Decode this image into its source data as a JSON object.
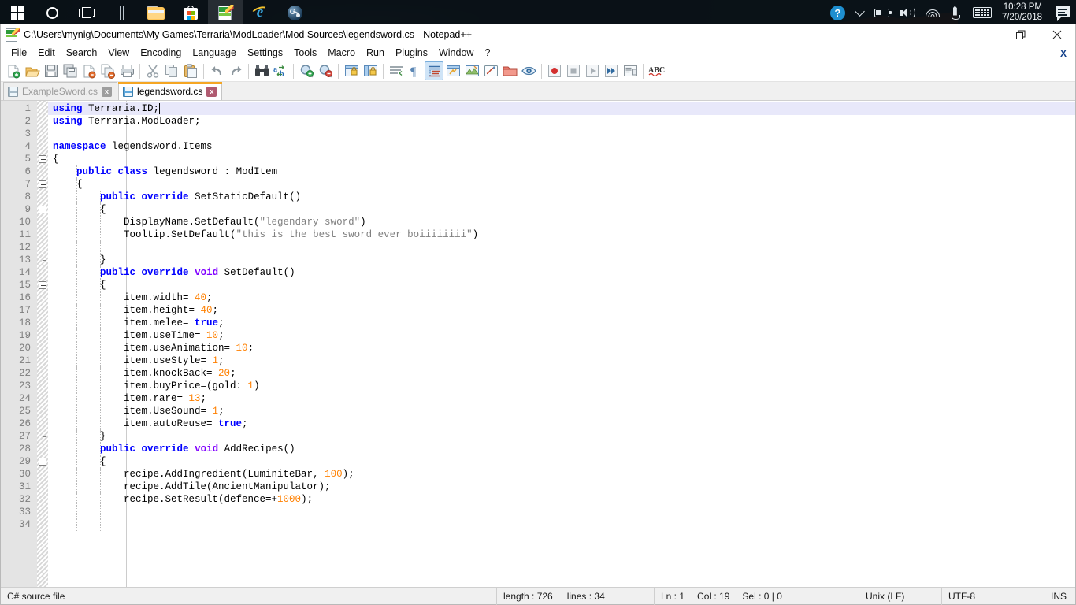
{
  "taskbar": {
    "items": [
      {
        "name": "start-button",
        "icon": "windows-logo-icon",
        "label": "Start"
      },
      {
        "name": "cortana-button",
        "icon": "cortana-circle-icon",
        "label": "Cortana"
      },
      {
        "name": "task-view-button",
        "icon": "task-view-icon",
        "label": "Task View"
      },
      {
        "name": "file-explorer-button",
        "icon": "folder-icon",
        "label": "File Explorer"
      },
      {
        "name": "microsoft-store-button",
        "icon": "store-bag-icon",
        "label": "Microsoft Store"
      },
      {
        "name": "notepadpp-taskbar-button",
        "icon": "notepad-plus-plus-icon",
        "label": "Notepad++"
      },
      {
        "name": "internet-explorer-button",
        "icon": "internet-explorer-icon",
        "label": "Internet Explorer"
      },
      {
        "name": "steam-button",
        "icon": "steam-icon",
        "label": "Steam"
      }
    ],
    "tray": {
      "help_icon": "help-question-icon",
      "help_glyph": "?",
      "chevron": "chevron-up-icon",
      "battery": "battery-icon",
      "volume": "volume-icon",
      "wifi": "wifi-icon",
      "pen": "pen-ink-icon",
      "keyboard": "touch-keyboard-icon",
      "time": "10:28 PM",
      "date": "7/20/2018",
      "action_center": "action-center-icon"
    }
  },
  "window": {
    "title": "C:\\Users\\mynig\\Documents\\My Games\\Terraria\\ModLoader\\Mod Sources\\legendsword.cs - Notepad++",
    "icon": "notepad-plus-plus-icon",
    "minimize": "minimize-icon",
    "maximize": "restore-icon",
    "close": "close-icon",
    "document_close_label": "X"
  },
  "menu": {
    "items": [
      {
        "label": "File"
      },
      {
        "label": "Edit"
      },
      {
        "label": "Search"
      },
      {
        "label": "View"
      },
      {
        "label": "Encoding"
      },
      {
        "label": "Language"
      },
      {
        "label": "Settings"
      },
      {
        "label": "Tools"
      },
      {
        "label": "Macro"
      },
      {
        "label": "Run"
      },
      {
        "label": "Plugins"
      },
      {
        "label": "Window"
      },
      {
        "label": "?"
      }
    ]
  },
  "toolbar": {
    "buttons": [
      {
        "name": "new-file-button",
        "icon": "new-document-icon"
      },
      {
        "name": "open-file-button",
        "icon": "open-folder-icon"
      },
      {
        "name": "save-button",
        "icon": "save-floppy-icon"
      },
      {
        "name": "save-all-button",
        "icon": "save-all-icon"
      },
      {
        "name": "close-button",
        "icon": "close-document-icon"
      },
      {
        "name": "close-all-button",
        "icon": "close-all-documents-icon"
      },
      {
        "name": "print-button",
        "icon": "printer-icon"
      },
      {
        "name": "cut-button",
        "icon": "scissors-icon"
      },
      {
        "name": "copy-button",
        "icon": "copy-icon"
      },
      {
        "name": "paste-button",
        "icon": "paste-clipboard-icon"
      },
      {
        "name": "undo-button",
        "icon": "undo-arrow-icon"
      },
      {
        "name": "redo-button",
        "icon": "redo-arrow-icon"
      },
      {
        "name": "find-button",
        "icon": "binoculars-find-icon"
      },
      {
        "name": "replace-button",
        "icon": "replace-ab-icon"
      },
      {
        "name": "zoom-in-button",
        "icon": "magnifier-plus-icon"
      },
      {
        "name": "zoom-out-button",
        "icon": "magnifier-minus-icon"
      },
      {
        "name": "sync-vertical-scroll-button",
        "icon": "sync-vertical-lock-icon"
      },
      {
        "name": "sync-horizontal-scroll-button",
        "icon": "sync-horizontal-lock-icon"
      },
      {
        "name": "word-wrap-button",
        "icon": "word-wrap-icon"
      },
      {
        "name": "show-all-characters-button",
        "icon": "pilcrow-icon"
      },
      {
        "name": "indent-guide-button",
        "icon": "indent-guide-icon",
        "selected": true
      },
      {
        "name": "user-defined-dialog-button",
        "icon": "udl-dialog-icon"
      },
      {
        "name": "document-map-button",
        "icon": "document-map-icon"
      },
      {
        "name": "function-list-button",
        "icon": "function-list-icon"
      },
      {
        "name": "folder-as-workspace-button",
        "icon": "folder-workspace-icon"
      },
      {
        "name": "monitoring-button",
        "icon": "eye-monitor-icon"
      },
      {
        "name": "start-recording-button",
        "icon": "record-dot-icon"
      },
      {
        "name": "stop-recording-button",
        "icon": "stop-square-icon"
      },
      {
        "name": "playback-button",
        "icon": "play-triangle-icon"
      },
      {
        "name": "run-macro-multiple-button",
        "icon": "fast-forward-icon"
      },
      {
        "name": "save-macro-button",
        "icon": "save-macro-icon"
      },
      {
        "name": "spell-check-button",
        "icon": "abc-spellcheck-icon"
      }
    ]
  },
  "tabs": [
    {
      "label": "ExampleSword.cs",
      "active": false,
      "close": "x"
    },
    {
      "label": "legendsword.cs",
      "active": true,
      "close": "x"
    }
  ],
  "editor": {
    "caret_line": 1,
    "caret_col": 19,
    "lines": [
      {
        "n": 1,
        "tokens": [
          {
            "t": "using",
            "c": "kw"
          },
          {
            "t": " Terraria.ID;",
            "c": ""
          }
        ],
        "fold": "none"
      },
      {
        "n": 2,
        "tokens": [
          {
            "t": "using",
            "c": "kw"
          },
          {
            "t": " Terraria.ModLoader;",
            "c": ""
          }
        ],
        "fold": "none"
      },
      {
        "n": 3,
        "tokens": [],
        "fold": "none"
      },
      {
        "n": 4,
        "tokens": [
          {
            "t": "namespace",
            "c": "kw"
          },
          {
            "t": " legendsword.Items",
            "c": ""
          }
        ],
        "fold": "none"
      },
      {
        "n": 5,
        "tokens": [
          {
            "t": "{",
            "c": ""
          }
        ],
        "fold": "box"
      },
      {
        "n": 6,
        "tokens": [
          {
            "t": "    ",
            "c": ""
          },
          {
            "t": "public",
            "c": "kw"
          },
          {
            "t": " ",
            "c": ""
          },
          {
            "t": "class",
            "c": "kw"
          },
          {
            "t": " legendsword : ModItem",
            "c": ""
          }
        ],
        "fold": "line"
      },
      {
        "n": 7,
        "tokens": [
          {
            "t": "    {",
            "c": ""
          }
        ],
        "fold": "box"
      },
      {
        "n": 8,
        "tokens": [
          {
            "t": "        ",
            "c": ""
          },
          {
            "t": "public",
            "c": "kw"
          },
          {
            "t": " ",
            "c": ""
          },
          {
            "t": "override",
            "c": "kw"
          },
          {
            "t": " SetStaticDefault()",
            "c": ""
          }
        ],
        "fold": "line"
      },
      {
        "n": 9,
        "tokens": [
          {
            "t": "        {",
            "c": ""
          }
        ],
        "fold": "box"
      },
      {
        "n": 10,
        "tokens": [
          {
            "t": "            DisplayName.SetDefault(",
            "c": ""
          },
          {
            "t": "\"legendary sword\"",
            "c": "str"
          },
          {
            "t": ")",
            "c": ""
          }
        ],
        "fold": "line"
      },
      {
        "n": 11,
        "tokens": [
          {
            "t": "            Tooltip.SetDefault(",
            "c": ""
          },
          {
            "t": "\"this is the best sword ever boiiiiiiii\"",
            "c": "str"
          },
          {
            "t": ")",
            "c": ""
          }
        ],
        "fold": "line"
      },
      {
        "n": 12,
        "tokens": [],
        "fold": "line"
      },
      {
        "n": 13,
        "tokens": [
          {
            "t": "        }",
            "c": ""
          }
        ],
        "fold": "end"
      },
      {
        "n": 14,
        "tokens": [
          {
            "t": "        ",
            "c": ""
          },
          {
            "t": "public",
            "c": "kw"
          },
          {
            "t": " ",
            "c": ""
          },
          {
            "t": "override",
            "c": "kw"
          },
          {
            "t": " ",
            "c": ""
          },
          {
            "t": "void",
            "c": "kw2"
          },
          {
            "t": " SetDefault()",
            "c": ""
          }
        ],
        "fold": "line"
      },
      {
        "n": 15,
        "tokens": [
          {
            "t": "        {",
            "c": ""
          }
        ],
        "fold": "box"
      },
      {
        "n": 16,
        "tokens": [
          {
            "t": "            item.width= ",
            "c": ""
          },
          {
            "t": "40",
            "c": "num"
          },
          {
            "t": ";",
            "c": ""
          }
        ],
        "fold": "line"
      },
      {
        "n": 17,
        "tokens": [
          {
            "t": "            item.height= ",
            "c": ""
          },
          {
            "t": "40",
            "c": "num"
          },
          {
            "t": ";",
            "c": ""
          }
        ],
        "fold": "line"
      },
      {
        "n": 18,
        "tokens": [
          {
            "t": "            item.melee= ",
            "c": ""
          },
          {
            "t": "true",
            "c": "kw"
          },
          {
            "t": ";",
            "c": ""
          }
        ],
        "fold": "line"
      },
      {
        "n": 19,
        "tokens": [
          {
            "t": "            item.useTime= ",
            "c": ""
          },
          {
            "t": "10",
            "c": "num"
          },
          {
            "t": ";",
            "c": ""
          }
        ],
        "fold": "line"
      },
      {
        "n": 20,
        "tokens": [
          {
            "t": "            item.useAnimation= ",
            "c": ""
          },
          {
            "t": "10",
            "c": "num"
          },
          {
            "t": ";",
            "c": ""
          }
        ],
        "fold": "line"
      },
      {
        "n": 21,
        "tokens": [
          {
            "t": "            item.useStyle= ",
            "c": ""
          },
          {
            "t": "1",
            "c": "num"
          },
          {
            "t": ";",
            "c": ""
          }
        ],
        "fold": "line"
      },
      {
        "n": 22,
        "tokens": [
          {
            "t": "            item.knockBack= ",
            "c": ""
          },
          {
            "t": "20",
            "c": "num"
          },
          {
            "t": ";",
            "c": ""
          }
        ],
        "fold": "line"
      },
      {
        "n": 23,
        "tokens": [
          {
            "t": "            item.buyPrice=(gold: ",
            "c": ""
          },
          {
            "t": "1",
            "c": "num"
          },
          {
            "t": ")",
            "c": ""
          }
        ],
        "fold": "line"
      },
      {
        "n": 24,
        "tokens": [
          {
            "t": "            item.rare= ",
            "c": ""
          },
          {
            "t": "13",
            "c": "num"
          },
          {
            "t": ";",
            "c": ""
          }
        ],
        "fold": "line"
      },
      {
        "n": 25,
        "tokens": [
          {
            "t": "            item.UseSound= ",
            "c": ""
          },
          {
            "t": "1",
            "c": "num"
          },
          {
            "t": ";",
            "c": ""
          }
        ],
        "fold": "line"
      },
      {
        "n": 26,
        "tokens": [
          {
            "t": "            item.autoReuse= ",
            "c": ""
          },
          {
            "t": "true",
            "c": "kw"
          },
          {
            "t": ";",
            "c": ""
          }
        ],
        "fold": "line"
      },
      {
        "n": 27,
        "tokens": [
          {
            "t": "        }",
            "c": ""
          }
        ],
        "fold": "end"
      },
      {
        "n": 28,
        "tokens": [
          {
            "t": "        ",
            "c": ""
          },
          {
            "t": "public",
            "c": "kw"
          },
          {
            "t": " ",
            "c": ""
          },
          {
            "t": "override",
            "c": "kw"
          },
          {
            "t": " ",
            "c": ""
          },
          {
            "t": "void",
            "c": "kw2"
          },
          {
            "t": " AddRecipes()",
            "c": ""
          }
        ],
        "fold": "line"
      },
      {
        "n": 29,
        "tokens": [
          {
            "t": "        {",
            "c": ""
          }
        ],
        "fold": "box"
      },
      {
        "n": 30,
        "tokens": [
          {
            "t": "            recipe.AddIngredient(LuminiteBar, ",
            "c": ""
          },
          {
            "t": "100",
            "c": "num"
          },
          {
            "t": ");",
            "c": ""
          }
        ],
        "fold": "line"
      },
      {
        "n": 31,
        "tokens": [
          {
            "t": "            recipe.AddTile(AncientManipulator);",
            "c": ""
          }
        ],
        "fold": "line"
      },
      {
        "n": 32,
        "tokens": [
          {
            "t": "            recipe.SetResult(defence=+",
            "c": ""
          },
          {
            "t": "1000",
            "c": "num"
          },
          {
            "t": ");",
            "c": ""
          }
        ],
        "fold": "line"
      },
      {
        "n": 33,
        "tokens": [],
        "fold": "line"
      },
      {
        "n": 34,
        "tokens": [],
        "fold": "end"
      }
    ]
  },
  "statusbar": {
    "file_type": "C# source file",
    "length_label": "length : 726",
    "lines_label": "lines : 34",
    "ln": "Ln : 1",
    "col": "Col : 19",
    "sel": "Sel : 0 | 0",
    "eol": "Unix (LF)",
    "encoding": "UTF-8",
    "insert_mode": "INS"
  },
  "colors": {
    "keyword": "#0000ff",
    "type_keyword": "#8000ff",
    "string": "#808080",
    "number": "#ff8000",
    "active_tab_accent": "#f5a623",
    "gutter_bg": "#e4e4e4",
    "current_line_bg": "#e8e8fa"
  }
}
